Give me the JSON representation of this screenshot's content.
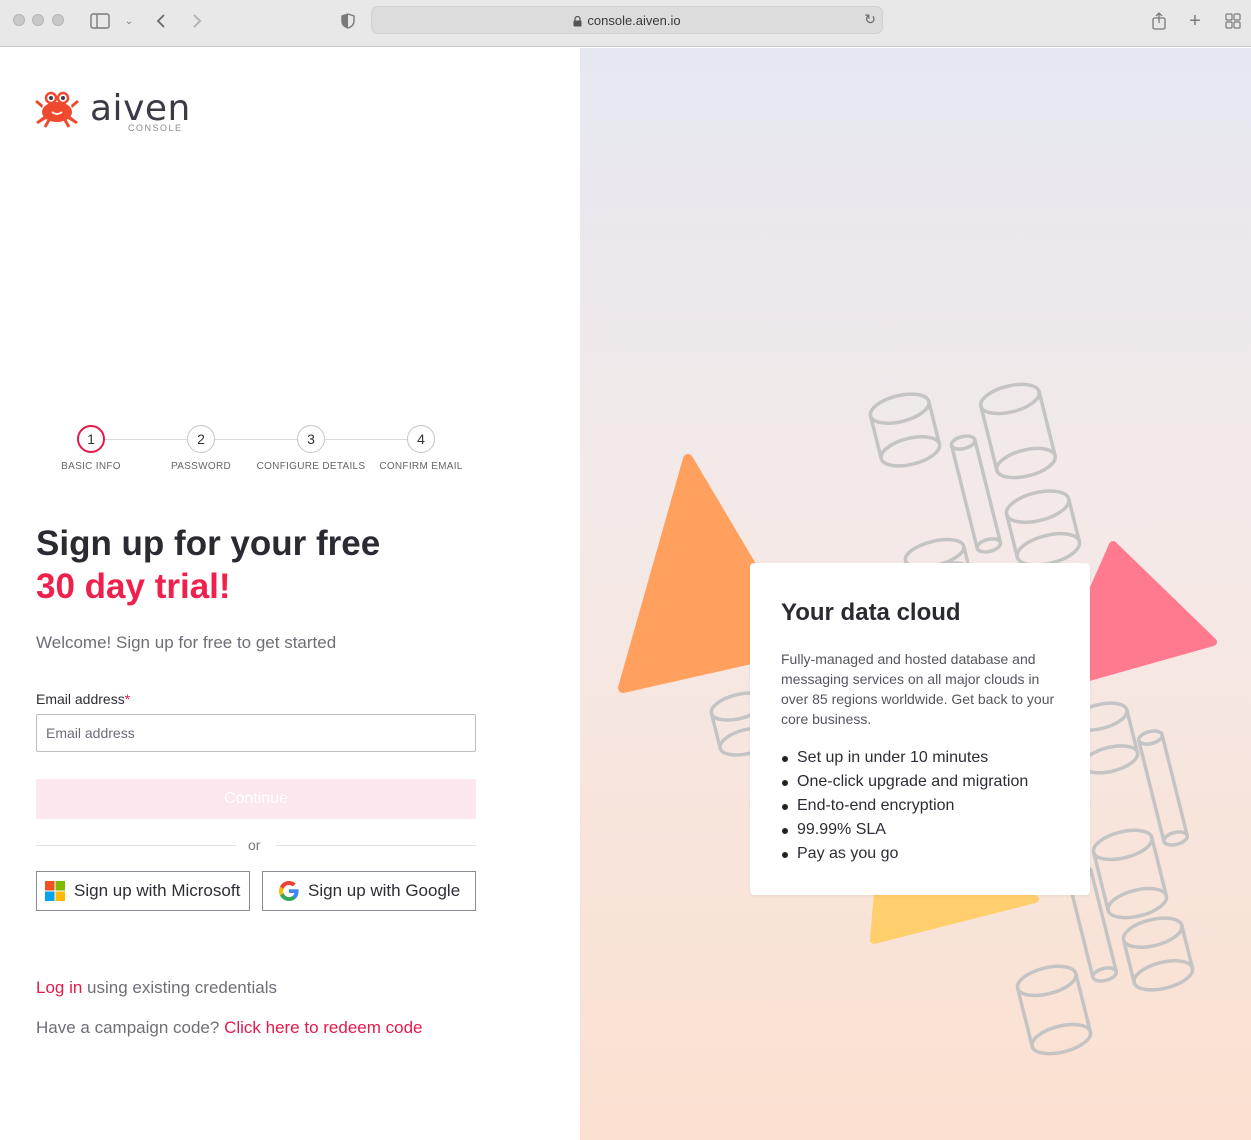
{
  "browser": {
    "url": "console.aiven.io"
  },
  "logo": {
    "wordmark": "aiven",
    "sub": "CONSOLE"
  },
  "stepper": {
    "steps": [
      {
        "number": "1",
        "label": "BASIC INFO",
        "active": true
      },
      {
        "number": "2",
        "label": "PASSWORD",
        "active": false
      },
      {
        "number": "3",
        "label": "CONFIGURE DETAILS",
        "active": false
      },
      {
        "number": "4",
        "label": "CONFIRM EMAIL",
        "active": false
      }
    ]
  },
  "signup": {
    "title_line1": "Sign up for your free",
    "title_line2": "30 day trial!",
    "welcome": "Welcome! Sign up for free to get started",
    "email_label": "Email address",
    "required_mark": "*",
    "email_placeholder": "Email address",
    "email_value": "",
    "continue_label": "Continue",
    "or_text": "or",
    "microsoft_label": "Sign up with Microsoft",
    "google_label": "Sign up with Google",
    "login_link": "Log in",
    "login_rest": " using existing credentials",
    "campaign_text": "Have a campaign code? ",
    "campaign_link": "Click here to redeem code"
  },
  "promo": {
    "title": "Your data cloud",
    "description": "Fully-managed and hosted database and messaging services on all major clouds in over 85 regions worldwide. Get back to your core business.",
    "bullets": [
      "Set up in under 10 minutes",
      "One-click upgrade and migration",
      "End-to-end encryption",
      "99.99% SLA",
      "Pay as you go"
    ]
  },
  "colors": {
    "accent": "#e41a4a",
    "continue_disabled": "#fde7ef",
    "triangle_orange": "#ffa05f",
    "triangle_pink": "#ff7a8f",
    "triangle_yellow": "#ffcf6e"
  }
}
